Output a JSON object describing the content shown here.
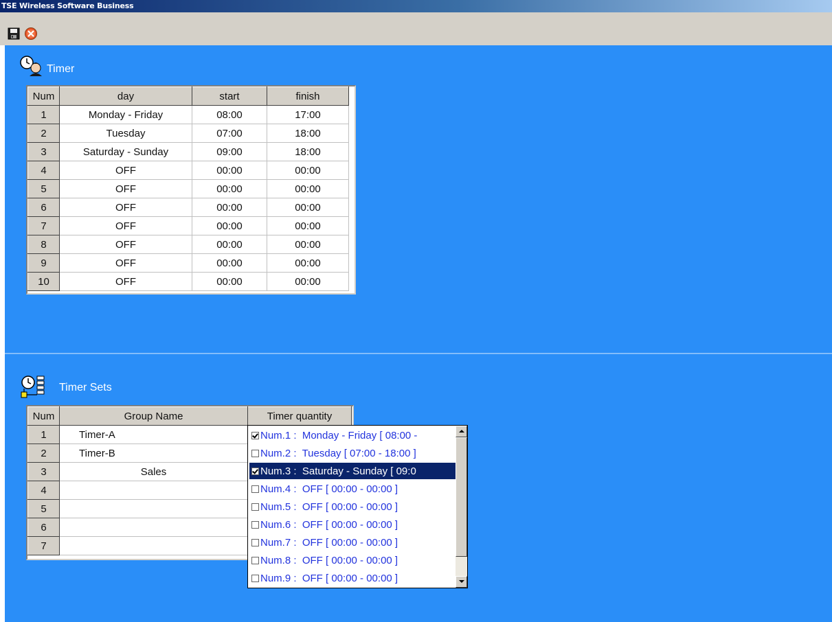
{
  "window": {
    "title": "TSE Wireless Software Business"
  },
  "toolbar": {
    "save_icon": "floppy-disk-icon",
    "close_icon": "close-icon"
  },
  "timer": {
    "title": "Timer",
    "icon": "clock-person-icon",
    "columns": [
      "Num",
      "day",
      "start",
      "finish"
    ],
    "rows": [
      [
        "1",
        "Monday - Friday",
        "08:00",
        "17:00"
      ],
      [
        "2",
        "Tuesday",
        "07:00",
        "18:00"
      ],
      [
        "3",
        "Saturday - Sunday",
        "09:00",
        "18:00"
      ],
      [
        "4",
        "OFF",
        "00:00",
        "00:00"
      ],
      [
        "5",
        "OFF",
        "00:00",
        "00:00"
      ],
      [
        "6",
        "OFF",
        "00:00",
        "00:00"
      ],
      [
        "7",
        "OFF",
        "00:00",
        "00:00"
      ],
      [
        "8",
        "OFF",
        "00:00",
        "00:00"
      ],
      [
        "9",
        "OFF",
        "00:00",
        "00:00"
      ],
      [
        "10",
        "OFF",
        "00:00",
        "00:00"
      ]
    ]
  },
  "timer_sets": {
    "title": "Timer Sets",
    "icon": "clock-list-icon",
    "columns": [
      "Num",
      "Group Name",
      "Timer quantity"
    ],
    "rows": [
      [
        "1",
        "Timer-A",
        ""
      ],
      [
        "2",
        "Timer-B",
        ""
      ],
      [
        "3",
        "Sales",
        ""
      ],
      [
        "4",
        "",
        ""
      ],
      [
        "5",
        "",
        ""
      ],
      [
        "6",
        "",
        ""
      ],
      [
        "7",
        "",
        ""
      ]
    ]
  },
  "timer_dropdown": {
    "items": [
      {
        "label": "Num.1 :  Monday - Friday [ 08:00 - ",
        "checked": true,
        "selected": false
      },
      {
        "label": "Num.2 :  Tuesday [ 07:00 - 18:00 ]",
        "checked": false,
        "selected": false
      },
      {
        "label": "Num.3 :  Saturday - Sunday [ 09:0",
        "checked": true,
        "selected": true
      },
      {
        "label": "Num.4 :  OFF [ 00:00 - 00:00 ]",
        "checked": false,
        "selected": false
      },
      {
        "label": "Num.5 :  OFF [ 00:00 - 00:00 ]",
        "checked": false,
        "selected": false
      },
      {
        "label": "Num.6 :  OFF [ 00:00 - 00:00 ]",
        "checked": false,
        "selected": false
      },
      {
        "label": "Num.7 :  OFF [ 00:00 - 00:00 ]",
        "checked": false,
        "selected": false
      },
      {
        "label": "Num.8 :  OFF [ 00:00 - 00:00 ]",
        "checked": false,
        "selected": false
      },
      {
        "label": "Num.9 :  OFF [ 00:00 - 00:00 ]",
        "checked": false,
        "selected": false
      }
    ]
  },
  "colors": {
    "background": "#2a8ef8",
    "titlebar": "#0a246a",
    "dropdown_text": "#2233dd",
    "selection": "#0a246a"
  }
}
